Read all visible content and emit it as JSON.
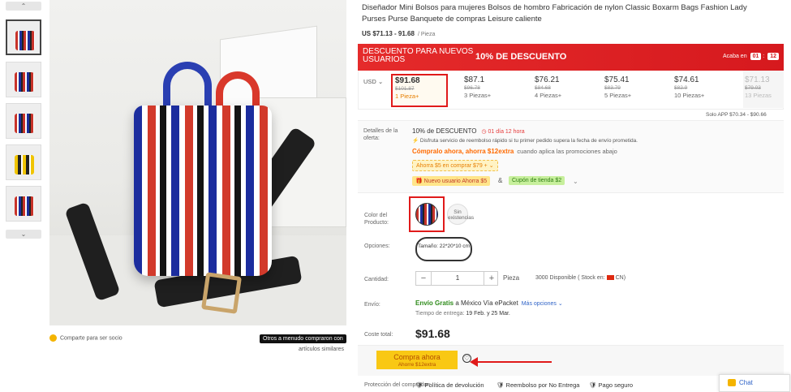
{
  "thumbnails": {
    "count": 5
  },
  "share": {
    "label": "Comparte para ser socio"
  },
  "often_bought": {
    "label": "Otros a menudo compraron con",
    "sub": "artículos similares"
  },
  "product": {
    "title": "Diseñador Mini Bolsos para mujeres Bolsos de hombro Fabricación de nylon Classic Boxarm Bags Fashion Lady Purses Purse Banquete de compras Leisure caliente",
    "price_range": "US $71.13 - 91.68",
    "unit": "/ Pieza"
  },
  "banner": {
    "left": "DESCUENTO PARA NUEVOS USUARIOS",
    "center": "10% DE DESCUENTO",
    "ends_label": "Acaba en",
    "h1": "01",
    "h2": "12"
  },
  "tiers": {
    "currency": "USD",
    "items": [
      {
        "price": "$91.68",
        "orig": "$101.87",
        "qty": "1 Pieza+"
      },
      {
        "price": "$87.1",
        "orig": "$96.78",
        "qty": "3 Piezas+"
      },
      {
        "price": "$76.21",
        "orig": "$84.68",
        "qty": "4 Piezas+"
      },
      {
        "price": "$75.41",
        "orig": "$83.79",
        "qty": "5 Piezas+"
      },
      {
        "price": "$74.61",
        "orig": "$82.9",
        "qty": "10 Piezas+"
      },
      {
        "price": "$71.13",
        "orig": "$79.03",
        "qty": "13 Piezas"
      }
    ],
    "solo_app": "Solo APP  $70.34 - $90.66"
  },
  "offer": {
    "label": "Detalles de la oferta:",
    "discount": "10% de DESCUENTO",
    "timer": "01 día 12 hora",
    "fast": "Disfruta servicio de reembolso rápido si tu primer pedido supera la fecha de envío prometida.",
    "buy_promo": "Cómpralo ahora, ahorra  $12extra",
    "buy_promo_note": "cuando aplica las promociones abajo",
    "chip1": "Ahorra  $5  en comprar  $79 +",
    "chip2": "Nuevo usuario Ahorra $5",
    "amp": "&",
    "chip3": "Cupón de tienda  $2"
  },
  "color": {
    "label": "Color del Producto:",
    "alt": "Sin existencias"
  },
  "options": {
    "label": "Opciones:",
    "size": "Tamaño: 22*20*10 cm"
  },
  "quantity": {
    "label": "Cantidad:",
    "value": "1",
    "unit": "Pieza",
    "stock": "3000  Disponible ( Stock en:",
    "stock_loc": "CN)"
  },
  "shipping": {
    "label": "Envío:",
    "free": "Envío Gratis",
    "dest": " a México Vía ePacket",
    "more": "Más opciones",
    "time_label": "Tiempo de entrega: ",
    "time": "19 Feb. y 25 Mar."
  },
  "total": {
    "label": "Coste total:",
    "value": "$91.68"
  },
  "buy": {
    "label": "Compra ahora",
    "sub": "Ahorre $12extra"
  },
  "protection": {
    "label": "Protección del comprador:",
    "items": [
      "Política de devolución",
      "Reembolso por No Entrega",
      "Pago seguro"
    ]
  },
  "chat": {
    "label": "Chat"
  }
}
